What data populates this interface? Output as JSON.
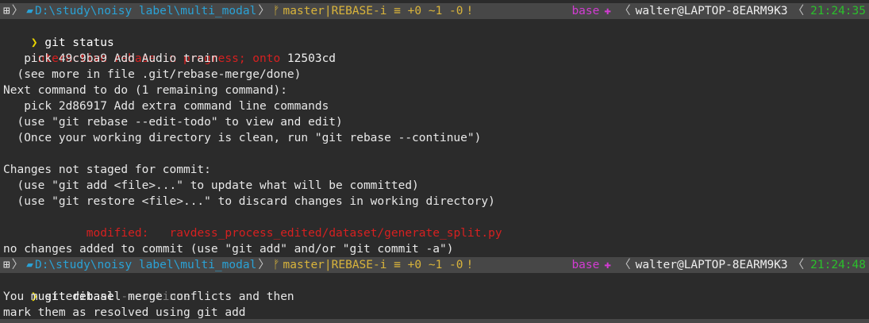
{
  "prompt_bars": [
    {
      "win_icon": "⊞",
      "folder_icon": "📁",
      "path": "D:\\study\\noisy label\\multi_modal",
      "branch_icon": "ᚠ",
      "git_status": "master|REBASE-i ≡ +0 ~1 -0",
      "git_warn": "!",
      "conda_env": "base",
      "conda_icon": "✚",
      "user": "walter@LAPTOP-8EARM9K3",
      "time": "21:24:35"
    },
    {
      "win_icon": "⊞",
      "folder_icon": "📁",
      "path": "D:\\study\\noisy label\\multi_modal",
      "branch_icon": "ᚠ",
      "git_status": "master|REBASE-i ≡ +0 ~1 -0",
      "git_warn": "!",
      "conda_env": "base",
      "conda_icon": "✚",
      "user": "walter@LAPTOP-8EARM9K3",
      "time": "21:24:48"
    }
  ],
  "prompt_symbol": "❯",
  "command1": "git status",
  "command2_main": "git rebase ",
  "command2_arg": "--continue",
  "output1": {
    "rebase_status": "interactive rebase in progress; onto",
    "onto_hash": " 12503cd",
    "lines": [
      "   pick 49c9ba9 Add Audio train",
      "  (see more in file .git/rebase-merge/done)",
      "Next command to do (1 remaining command):",
      "   pick 2d86917 Add extra command line commands",
      "  (use \"git rebase --edit-todo\" to view and edit)",
      "  (Once your working directory is clean, run \"git rebase --continue\")",
      "",
      "Changes not staged for commit:",
      "  (use \"git add <file>...\" to update what will be committed)",
      "  (use \"git restore <file>...\" to discard changes in working directory)"
    ],
    "modified_label": "        modified:   ",
    "modified_file": "ravdess_process_edited/dataset/generate_split.py",
    "no_changes": "no changes added to commit (use \"git add\" and/or \"git commit -a\")"
  },
  "output2": {
    "lines": [
      "You must edit all merge conflicts and then",
      "mark them as resolved using git add"
    ]
  }
}
